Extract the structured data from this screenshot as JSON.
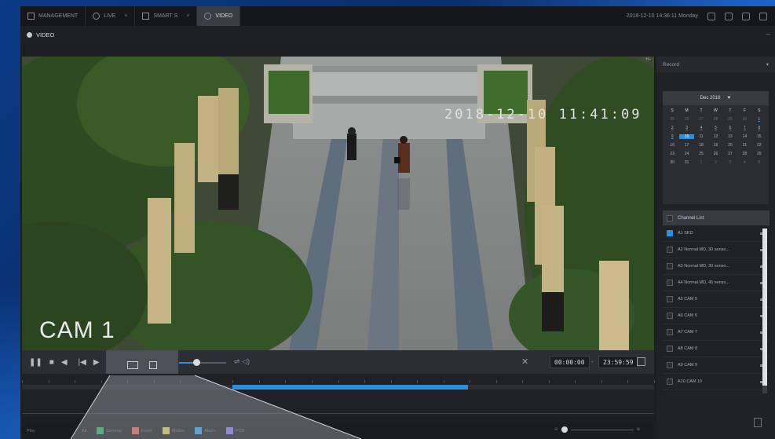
{
  "topbar": {
    "tabs": [
      {
        "label": "MANAGEMENT",
        "active": false
      },
      {
        "label": "LIVE",
        "active": false
      },
      {
        "label": "SMART S",
        "active": false
      },
      {
        "label": "VIDEO",
        "active": true
      }
    ],
    "datetime": "2018-12-10 14:36:11 Monday"
  },
  "title": "VIDEO",
  "video": {
    "camera_label": "CAM 1",
    "timestamp": "2018-12-10 11:41:09",
    "corner_text": "+/-"
  },
  "controls": {
    "start_time": "00:00:00",
    "separator": "-",
    "end_time": "23:59:59"
  },
  "legend": {
    "play_label": "Play",
    "items": [
      {
        "label": "All",
        "color": ""
      },
      {
        "label": "General",
        "color": "#2fb36a"
      },
      {
        "label": "Event",
        "color": "#e06a5a"
      },
      {
        "label": "Motion",
        "color": "#e8d45a"
      },
      {
        "label": "Alarm",
        "color": "#3aa0e6"
      },
      {
        "label": "POS",
        "color": "#8a7be6"
      }
    ]
  },
  "panel": {
    "record_label": "Record",
    "calendar": {
      "month": "Dec 2018",
      "weekdays": [
        "S",
        "M",
        "T",
        "W",
        "T",
        "F",
        "S"
      ],
      "days": [
        {
          "d": "25",
          "dim": true
        },
        {
          "d": "26",
          "dim": true
        },
        {
          "d": "27",
          "dim": true
        },
        {
          "d": "28",
          "dim": true
        },
        {
          "d": "29",
          "dim": true
        },
        {
          "d": "30",
          "dim": true
        },
        {
          "d": "1",
          "rec": true
        },
        {
          "d": "2",
          "rec": true
        },
        {
          "d": "3",
          "rec": true
        },
        {
          "d": "4",
          "rec": true
        },
        {
          "d": "5",
          "rec": true
        },
        {
          "d": "6",
          "rec": true
        },
        {
          "d": "7",
          "rec": true
        },
        {
          "d": "8",
          "rec": true
        },
        {
          "d": "9",
          "rec": true
        },
        {
          "d": "10",
          "sel": true
        },
        {
          "d": "11"
        },
        {
          "d": "12"
        },
        {
          "d": "13"
        },
        {
          "d": "14"
        },
        {
          "d": "15"
        },
        {
          "d": "16"
        },
        {
          "d": "17"
        },
        {
          "d": "18"
        },
        {
          "d": "19"
        },
        {
          "d": "20"
        },
        {
          "d": "21"
        },
        {
          "d": "22"
        },
        {
          "d": "23"
        },
        {
          "d": "24"
        },
        {
          "d": "25"
        },
        {
          "d": "26"
        },
        {
          "d": "27"
        },
        {
          "d": "28"
        },
        {
          "d": "29"
        },
        {
          "d": "30"
        },
        {
          "d": "31"
        },
        {
          "d": "1",
          "dim": true
        },
        {
          "d": "2",
          "dim": true
        },
        {
          "d": "3",
          "dim": true
        },
        {
          "d": "4",
          "dim": true
        },
        {
          "d": "5",
          "dim": true
        }
      ]
    },
    "channel_list_label": "Channel List",
    "channels": [
      {
        "name": "A1 SKD",
        "checked": true
      },
      {
        "name": "A2 Normal MD, 30 senso...",
        "checked": false
      },
      {
        "name": "A3 Normal MD, 30 senso...",
        "checked": false
      },
      {
        "name": "A4 Normal MD, 45 senso...",
        "checked": false
      },
      {
        "name": "A5 CAM 5",
        "checked": false
      },
      {
        "name": "A6 CAM 6",
        "checked": false
      },
      {
        "name": "A7 CAM 7",
        "checked": false
      },
      {
        "name": "A8 CAM 8",
        "checked": false
      },
      {
        "name": "A9 CAM 9",
        "checked": false
      },
      {
        "name": "A10 CAM 10",
        "checked": false
      }
    ]
  }
}
